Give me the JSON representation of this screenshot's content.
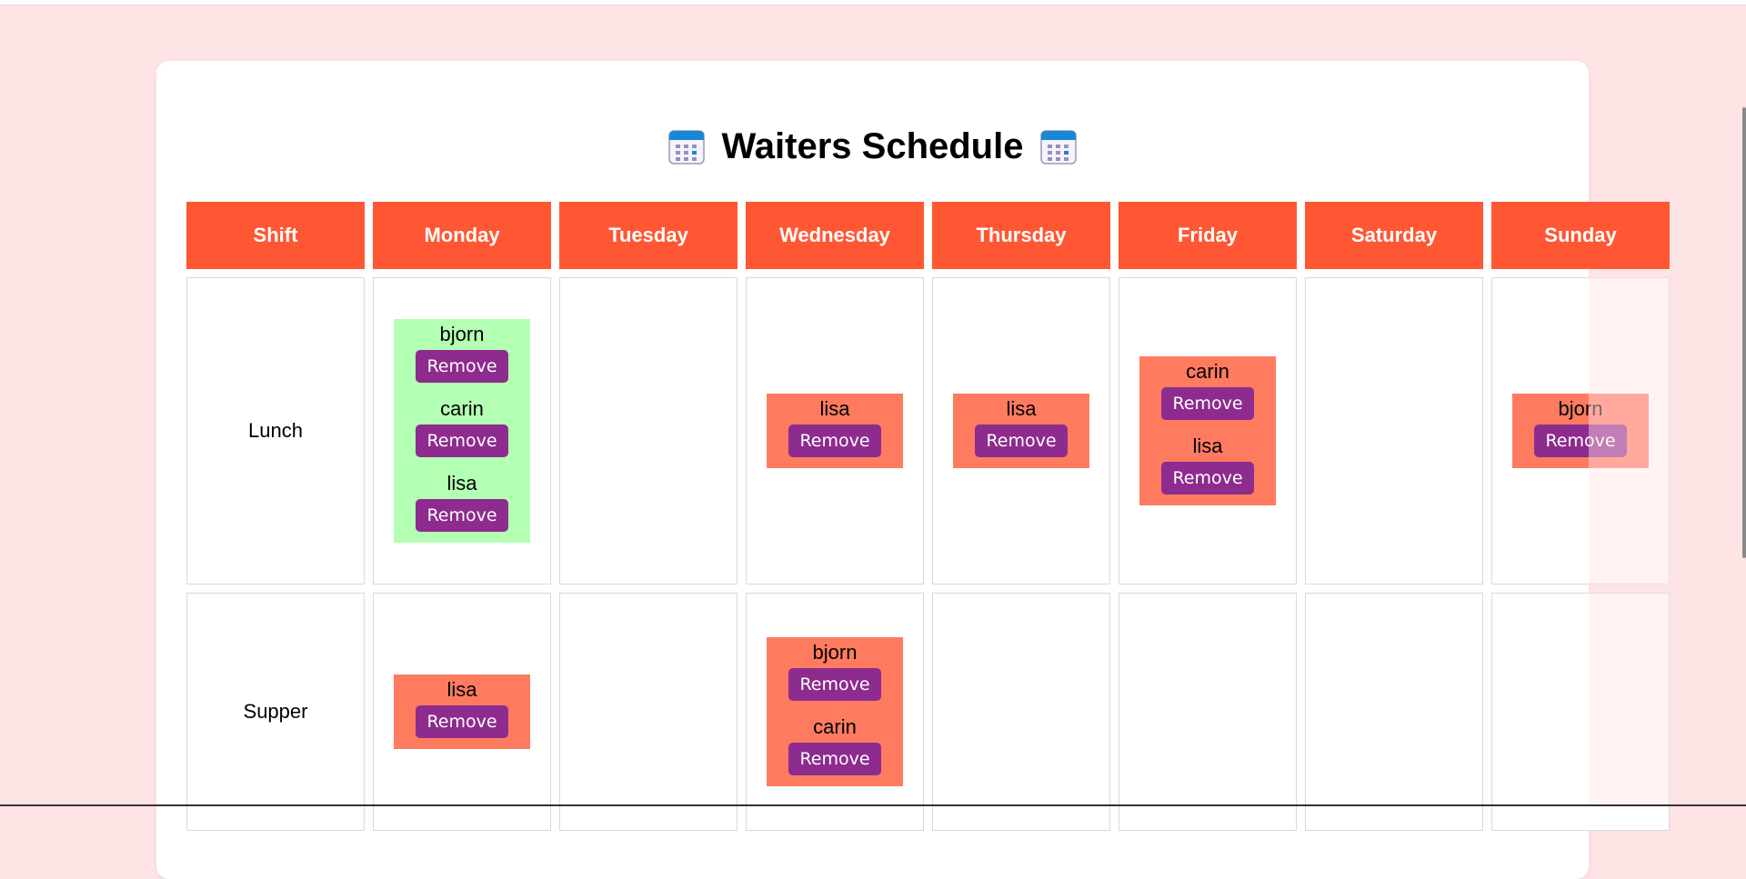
{
  "page": {
    "title": "Waiters Schedule",
    "title_icon": "calendar-icon"
  },
  "colors": {
    "background": "#ffe4e6",
    "header": "#ff5733",
    "assignment_box": "#ff7b5f",
    "assignment_box_full": "#b3ffb3",
    "remove_button": "#8e2b8e"
  },
  "table": {
    "headers": [
      "Shift",
      "Monday",
      "Tuesday",
      "Wednesday",
      "Thursday",
      "Friday",
      "Saturday",
      "Sunday"
    ],
    "rows": [
      {
        "shift": "Lunch",
        "days": [
          {
            "full": true,
            "waiters": [
              "bjorn",
              "carin",
              "lisa"
            ]
          },
          {
            "full": false,
            "waiters": []
          },
          {
            "full": false,
            "waiters": [
              "lisa"
            ]
          },
          {
            "full": false,
            "waiters": [
              "lisa"
            ]
          },
          {
            "full": false,
            "waiters": [
              "carin",
              "lisa"
            ]
          },
          {
            "full": false,
            "waiters": []
          },
          {
            "full": false,
            "waiters": [
              "bjorn"
            ]
          }
        ]
      },
      {
        "shift": "Supper",
        "days": [
          {
            "full": false,
            "waiters": [
              "lisa"
            ]
          },
          {
            "full": false,
            "waiters": []
          },
          {
            "full": false,
            "waiters": [
              "bjorn",
              "carin"
            ]
          },
          {
            "full": false,
            "waiters": []
          },
          {
            "full": false,
            "waiters": []
          },
          {
            "full": false,
            "waiters": []
          },
          {
            "full": false,
            "waiters": []
          }
        ]
      }
    ],
    "remove_label": "Remove"
  }
}
